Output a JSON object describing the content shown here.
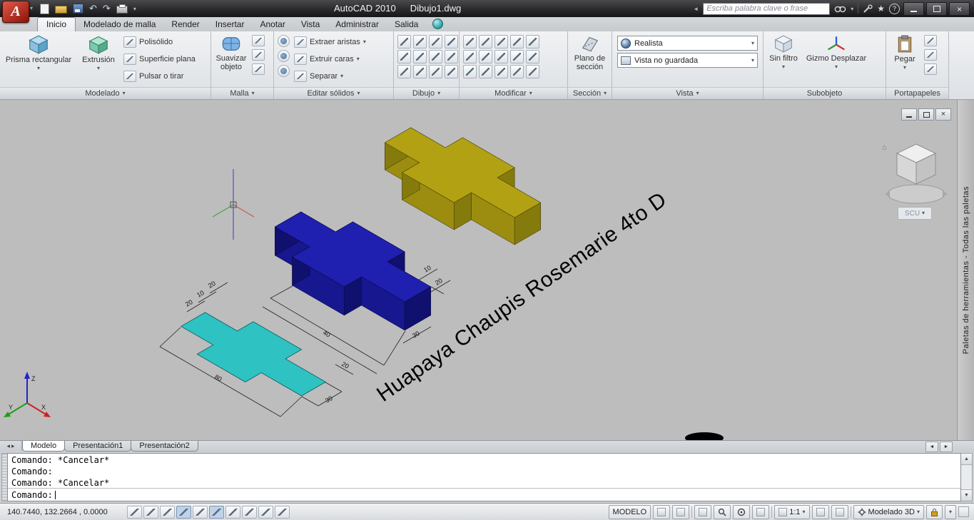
{
  "titlebar": {
    "app_name": "AutoCAD 2010",
    "doc_name": "Dibujo1.dwg",
    "search_placeholder": "Escriba palabra clave o frase"
  },
  "glyphs": {
    "caret_down": "▾",
    "arrow_up": "▲",
    "arrow_down": "▼",
    "scroll_left": "◄",
    "scroll_right": "►",
    "tab_prev": "◂",
    "tab_next": "▸",
    "close": "×",
    "star": "★",
    "help": "?",
    "home": "⌂",
    "undo": "↶",
    "redo": "↷",
    "logo_letter": "A"
  },
  "ribbon": {
    "tabs": [
      {
        "label": "Inicio"
      },
      {
        "label": "Modelado de malla"
      },
      {
        "label": "Render"
      },
      {
        "label": "Insertar"
      },
      {
        "label": "Anotar"
      },
      {
        "label": "Vista"
      },
      {
        "label": "Administrar"
      },
      {
        "label": "Salida"
      }
    ],
    "panels": {
      "modelado": {
        "label": "Modelado",
        "prisma": "Prisma rectangular",
        "extrusion": "Extrusión",
        "polisolido": "Polisólido",
        "superficie": "Superficie plana",
        "pulsar": "Pulsar o tirar"
      },
      "malla": {
        "label": "Malla",
        "suavizar": "Suavizar objeto"
      },
      "editar": {
        "label": "Editar sólidos",
        "extraer": "Extraer aristas",
        "extruir": "Extruir caras",
        "separar": "Separar"
      },
      "dibujo": {
        "label": "Dibujo"
      },
      "modificar": {
        "label": "Modificar"
      },
      "seccion": {
        "label": "Sección",
        "plano": "Plano de sección"
      },
      "vista": {
        "label": "Vista",
        "estilo": "Realista",
        "vista_guardada": "Vista no guardada"
      },
      "subobjeto": {
        "label": "Subobjeto",
        "filtro": "Sin filtro",
        "gizmo": "Gizmo Desplazar"
      },
      "portapapeles": {
        "label": "Portapapeles",
        "pegar": "Pegar"
      }
    }
  },
  "canvas": {
    "annotation_text": "Huapaya Chaupis Rosemarie 4to D",
    "scu": "SCU",
    "palette_bar": "Paletas de herramientas - Todas las paletas",
    "dims": {
      "c1": "20",
      "c2": "10",
      "c3": "20",
      "c4": "80",
      "c5": "30",
      "c6": "20",
      "b1": "40",
      "b2": "30",
      "b3": "10",
      "b4": "20"
    },
    "colors": {
      "solid_yellow": "#b2a213",
      "solid_blue": "#1f1fb0",
      "solid_cyan": "#2fc2c2",
      "canvas_bg": "#bdbdbd"
    }
  },
  "layout_tabs": {
    "modelo": "Modelo",
    "pres1": "Presentación1",
    "pres2": "Presentación2"
  },
  "command": {
    "line1": "Comando: *Cancelar*",
    "line2": "Comando:",
    "line3": "Comando: *Cancelar*",
    "prompt": "Comando:"
  },
  "statusbar": {
    "coords": "140.7440, 132.2664 , 0.0000",
    "modelo": "MODELO",
    "scale": "1:1",
    "workspace": "Modelado 3D"
  }
}
